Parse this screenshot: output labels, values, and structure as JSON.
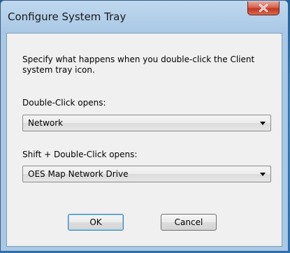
{
  "window": {
    "title": "Configure System Tray"
  },
  "content": {
    "description": "Specify what happens when you double-click the Client system tray icon.",
    "double_click_label": "Double-Click opens:",
    "double_click_value": "Network",
    "shift_double_click_label": "Shift + Double-Click opens:",
    "shift_double_click_value": "OES Map Network Drive"
  },
  "buttons": {
    "ok": "OK",
    "cancel": "Cancel"
  },
  "icons": {
    "close": "close-icon",
    "dropdown": "chevron-down-icon"
  }
}
